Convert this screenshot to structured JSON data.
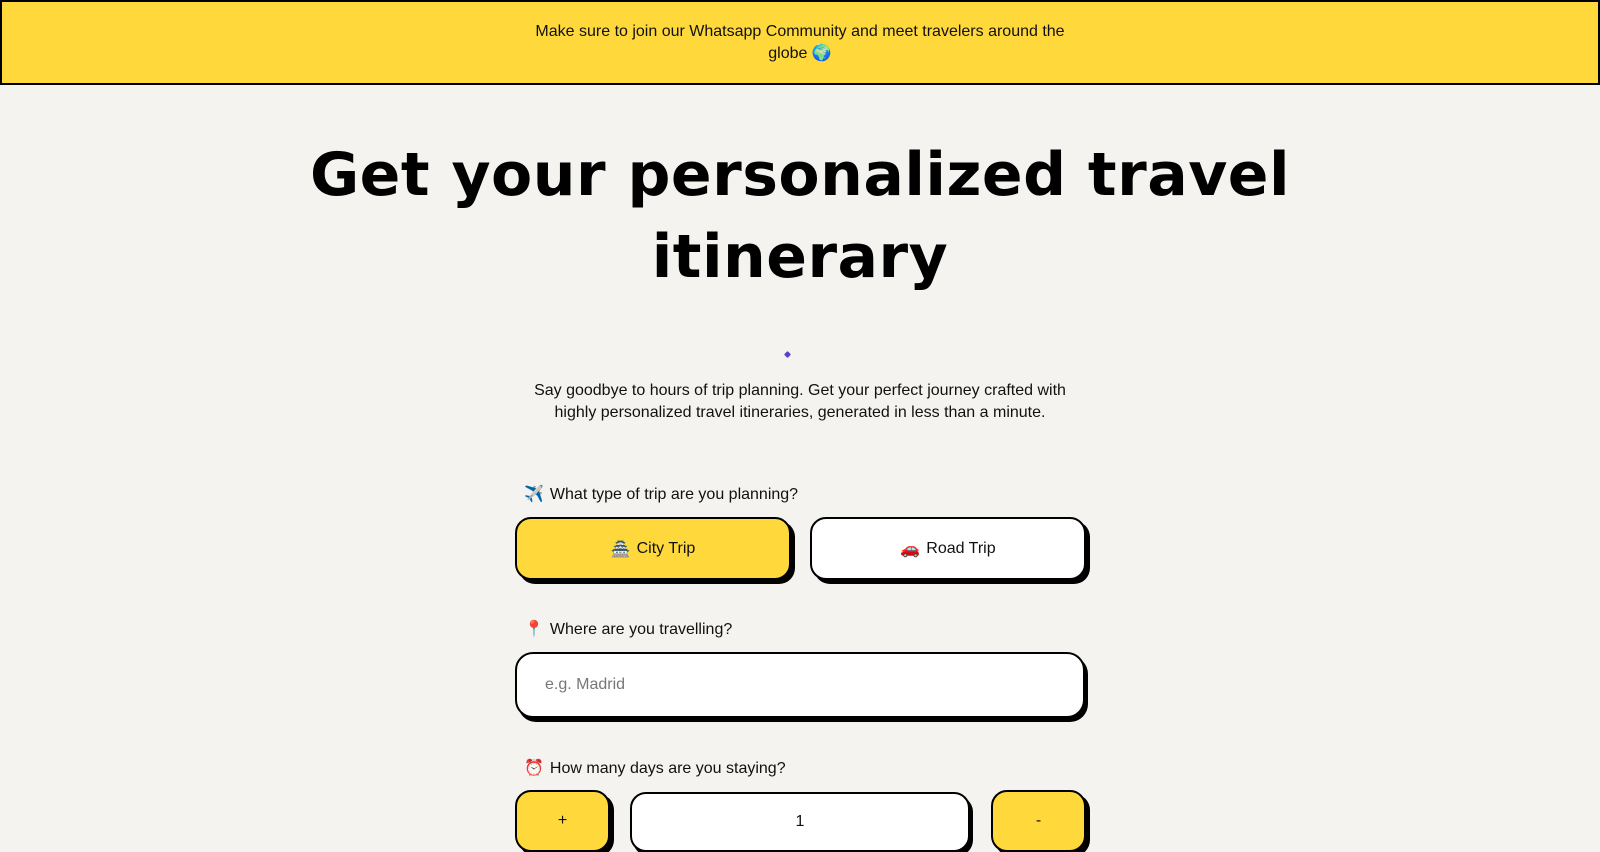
{
  "banner": {
    "text": "Make sure to join our Whatsapp Community and meet travelers around the globe 🌍"
  },
  "hero": {
    "title": "Get your personalized travel itinerary",
    "subtitle": "Say goodbye to hours of trip planning. Get your perfect journey crafted with highly personalized travel itineraries, generated in less than a minute."
  },
  "trip_type": {
    "icon": "✈️",
    "label": "What type of trip are you planning?",
    "options": [
      {
        "icon": "🏯",
        "label": "City Trip",
        "selected": true
      },
      {
        "icon": "🚗",
        "label": "Road Trip",
        "selected": false
      }
    ]
  },
  "destination": {
    "icon": "📍",
    "label": "Where are you travelling?",
    "placeholder": "e.g. Madrid",
    "value": ""
  },
  "days": {
    "icon": "⏰",
    "label": "How many days are you staying?",
    "increment_label": "+",
    "value": "1",
    "decrement_label": "-"
  },
  "colors": {
    "accent": "#ffd93b",
    "background": "#f4f3ef",
    "border": "#000000"
  }
}
